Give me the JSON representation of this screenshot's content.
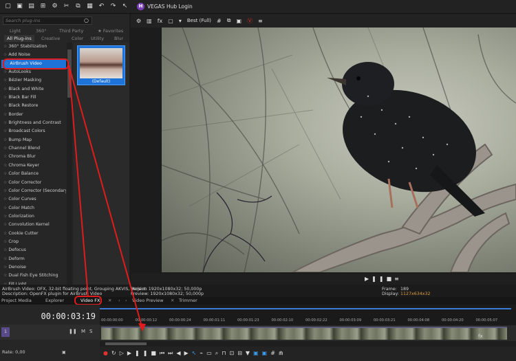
{
  "header": {
    "hub_label": "VEGAS Hub Login",
    "hub_logo": "H"
  },
  "plugins": {
    "search_placeholder": "Search plug-ins",
    "tabs": [
      "Light",
      "360°",
      "Third Party",
      "Favorites",
      "All Plug-ins",
      "Creative",
      "Color",
      "Utility",
      "Blur"
    ],
    "items": [
      "360° Stabilization",
      "Add Noise",
      "AirBrush Video",
      "AutoLooks",
      "Bézier Masking",
      "Black and White",
      "Black Bar Fill",
      "Black Restore",
      "Border",
      "Brightness and Contrast",
      "Broadcast Colors",
      "Bump Map",
      "Channel Blend",
      "Chroma Blur",
      "Chroma Keyer",
      "Color Balance",
      "Color Corrector",
      "Color Corrector (Secondary)",
      "Color Curves",
      "Color Match",
      "Colorization",
      "Convolution Kernel",
      "Cookie Cutter",
      "Crop",
      "Defocus",
      "Deform",
      "Denoise",
      "Dual Fish Eye Stitching",
      "Fill Light"
    ],
    "preset_caption": "(Default)"
  },
  "preview": {
    "quality": "Best (Full)"
  },
  "info": {
    "line1": "AirBrush Video: OFX, 32-bit floating point, Grouping AKVIS, Version",
    "line2": "Description: OpenFX plugin for AirBrush Video",
    "project_label": "Project:",
    "project_value": "1920x1080x32; 50,000p",
    "preview_label": "Preview:",
    "preview_value": "1920x1080x32; 50,000p",
    "frame_label": "Frame:",
    "frame_value": "189",
    "display_label": "Display:",
    "display_value": "1127x634x32"
  },
  "dock_tabs": [
    "Project Media",
    "Explorer",
    "Video FX",
    "Video Preview",
    "Trimmer"
  ],
  "timeline": {
    "timecode": "00:00:03:19",
    "track_number": "1",
    "mute": "M",
    "solo": "S",
    "rate": "Rate: 0,00",
    "ticks": [
      "00:00:00:00",
      "00:00:00:12",
      "00:00:00:24",
      "00:00:01:11",
      "00:00:01:23",
      "00:00:02:10",
      "00:00:02:22",
      "00:00:03:09",
      "00:00:03:21",
      "00:00:04:08",
      "00:00:04:20",
      "00:00:05:07"
    ]
  }
}
